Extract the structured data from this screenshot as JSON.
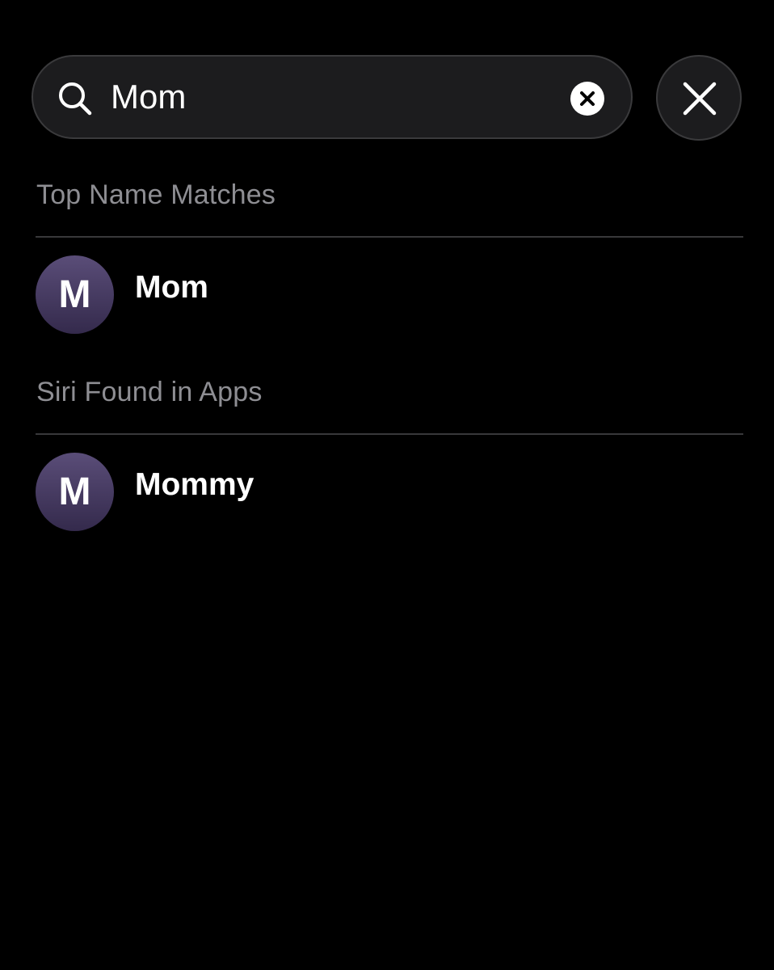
{
  "search": {
    "value": "Mom",
    "icon": "search-icon",
    "clear_icon": "clear-circle-icon"
  },
  "close_button": {
    "icon": "close-icon"
  },
  "sections": [
    {
      "header": "Top Name Matches",
      "results": [
        {
          "initial": "M",
          "name": "Mom"
        }
      ]
    },
    {
      "header": "Siri Found in Apps",
      "results": [
        {
          "initial": "M",
          "name": "Mommy"
        }
      ]
    }
  ],
  "colors": {
    "background": "#000000",
    "field": "#1c1c1e",
    "secondary_text": "#8e8e93",
    "avatar_top": "#5a4d78",
    "avatar_bottom": "#342a4c"
  }
}
